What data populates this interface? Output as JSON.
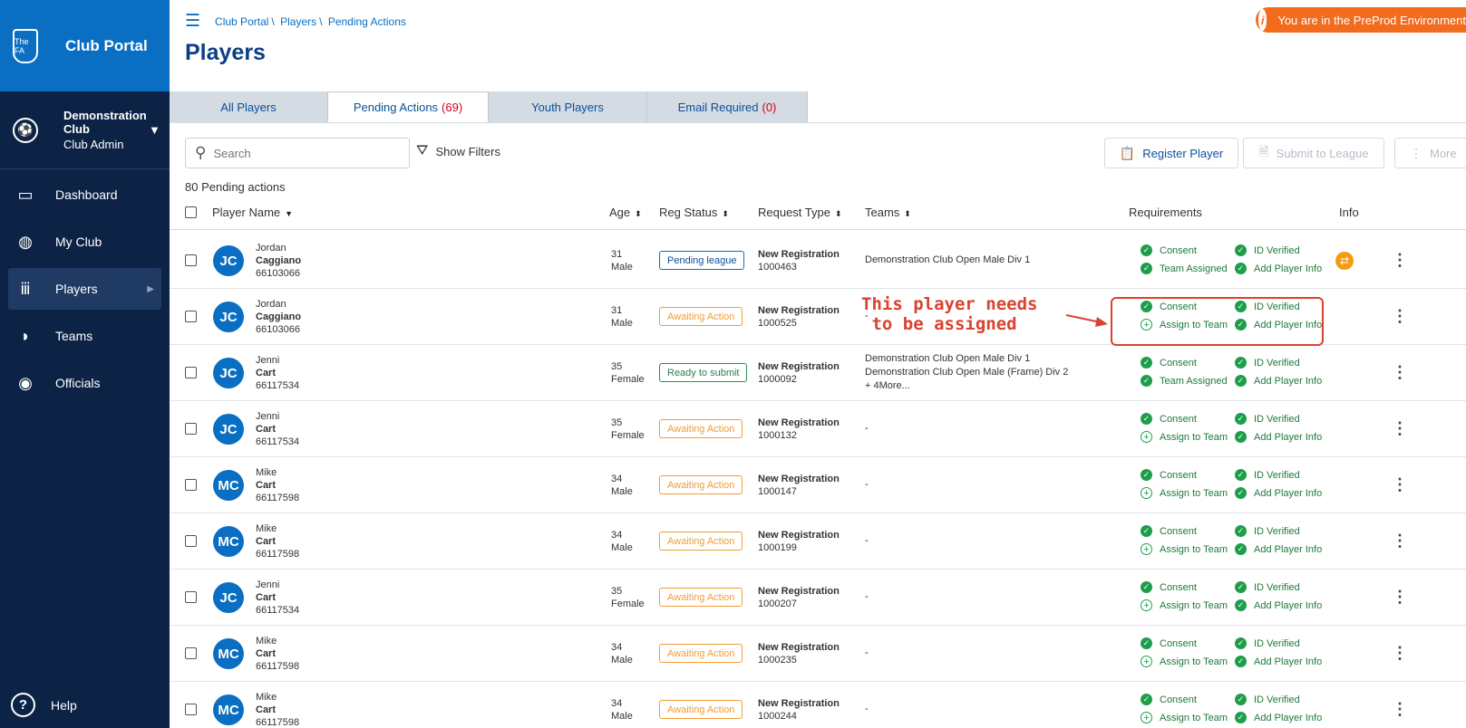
{
  "sidebar": {
    "app_title": "Club Portal",
    "crest_text": "The FA",
    "club_name": "Demonstration Club",
    "club_role": "Club Admin",
    "items": [
      {
        "label": "Dashboard",
        "icon": "dashboard-icon",
        "glyph": "▭"
      },
      {
        "label": "My Club",
        "icon": "shield-icon",
        "glyph": "◍"
      },
      {
        "label": "Players",
        "icon": "players-icon",
        "glyph": "ⅲ"
      },
      {
        "label": "Teams",
        "icon": "teams-icon",
        "glyph": "◗"
      },
      {
        "label": "Officials",
        "icon": "officials-icon",
        "glyph": "◉"
      }
    ],
    "help_label": "Help"
  },
  "breadcrumb": [
    "Club Portal",
    "Players",
    "Pending Actions"
  ],
  "environment_banner": "You are in the PreProd Environment",
  "page_title": "Players",
  "tabs": [
    {
      "label": "All Players",
      "count": ""
    },
    {
      "label": "Pending Actions",
      "count": "(69)"
    },
    {
      "label": "Youth Players",
      "count": ""
    },
    {
      "label": "Email Required",
      "count": "(0)"
    }
  ],
  "search": {
    "placeholder": "Search"
  },
  "show_filters": "Show Filters",
  "actions": {
    "register": "Register Player",
    "submit": "Submit to League",
    "more": "More"
  },
  "pending_count": "80 Pending actions",
  "columns": {
    "player_name": "Player Name",
    "age": "Age",
    "reg_status": "Reg Status",
    "request_type": "Request Type",
    "teams": "Teams",
    "requirements": "Requirements",
    "info": "Info"
  },
  "rows": [
    {
      "initials": "JC",
      "first": "Jordan",
      "last": "Caggiano",
      "id": "66103066",
      "age": "31",
      "gender": "Male",
      "status": "Pending league",
      "status_kind": "pending",
      "req_type": "New Registration",
      "req_no": "1000463",
      "teams": [
        "Demonstration Club Open Male Div 1"
      ],
      "consent": "Consent",
      "team_req": "Team Assigned",
      "team_done": true,
      "id_verified": "ID Verified",
      "player_info": "Add Player Info",
      "has_info": true
    },
    {
      "initials": "JC",
      "first": "Jordan",
      "last": "Caggiano",
      "id": "66103066",
      "age": "31",
      "gender": "Male",
      "status": "Awaiting Action",
      "status_kind": "await",
      "req_type": "New Registration",
      "req_no": "1000525",
      "teams": [
        "-"
      ],
      "consent": "Consent",
      "team_req": "Assign to Team",
      "team_done": false,
      "id_verified": "ID Verified",
      "player_info": "Add Player Info",
      "has_info": false
    },
    {
      "initials": "JC",
      "first": "Jenni",
      "last": "Cart",
      "id": "66117534",
      "age": "35",
      "gender": "Female",
      "status": "Ready to submit",
      "status_kind": "ready",
      "req_type": "New Registration",
      "req_no": "1000092",
      "teams": [
        "Demonstration Club Open Male Div 1",
        "Demonstration Club Open Male (Frame) Div 2",
        "+ 4More..."
      ],
      "consent": "Consent",
      "team_req": "Team Assigned",
      "team_done": true,
      "id_verified": "ID Verified",
      "player_info": "Add Player Info",
      "has_info": false
    },
    {
      "initials": "JC",
      "first": "Jenni",
      "last": "Cart",
      "id": "66117534",
      "age": "35",
      "gender": "Female",
      "status": "Awaiting Action",
      "status_kind": "await",
      "req_type": "New Registration",
      "req_no": "1000132",
      "teams": [
        "-"
      ],
      "consent": "Consent",
      "team_req": "Assign to Team",
      "team_done": false,
      "id_verified": "ID Verified",
      "player_info": "Add Player Info",
      "has_info": false
    },
    {
      "initials": "MC",
      "first": "Mike",
      "last": "Cart",
      "id": "66117598",
      "age": "34",
      "gender": "Male",
      "status": "Awaiting Action",
      "status_kind": "await",
      "req_type": "New Registration",
      "req_no": "1000147",
      "teams": [
        "-"
      ],
      "consent": "Consent",
      "team_req": "Assign to Team",
      "team_done": false,
      "id_verified": "ID Verified",
      "player_info": "Add Player Info",
      "has_info": false
    },
    {
      "initials": "MC",
      "first": "Mike",
      "last": "Cart",
      "id": "66117598",
      "age": "34",
      "gender": "Male",
      "status": "Awaiting Action",
      "status_kind": "await",
      "req_type": "New Registration",
      "req_no": "1000199",
      "teams": [
        "-"
      ],
      "consent": "Consent",
      "team_req": "Assign to Team",
      "team_done": false,
      "id_verified": "ID Verified",
      "player_info": "Add Player Info",
      "has_info": false
    },
    {
      "initials": "JC",
      "first": "Jenni",
      "last": "Cart",
      "id": "66117534",
      "age": "35",
      "gender": "Female",
      "status": "Awaiting Action",
      "status_kind": "await",
      "req_type": "New Registration",
      "req_no": "1000207",
      "teams": [
        "-"
      ],
      "consent": "Consent",
      "team_req": "Assign to Team",
      "team_done": false,
      "id_verified": "ID Verified",
      "player_info": "Add Player Info",
      "has_info": false
    },
    {
      "initials": "MC",
      "first": "Mike",
      "last": "Cart",
      "id": "66117598",
      "age": "34",
      "gender": "Male",
      "status": "Awaiting Action",
      "status_kind": "await",
      "req_type": "New Registration",
      "req_no": "1000235",
      "teams": [
        "-"
      ],
      "consent": "Consent",
      "team_req": "Assign to Team",
      "team_done": false,
      "id_verified": "ID Verified",
      "player_info": "Add Player Info",
      "has_info": false
    },
    {
      "initials": "MC",
      "first": "Mike",
      "last": "Cart",
      "id": "66117598",
      "age": "34",
      "gender": "Male",
      "status": "Awaiting Action",
      "status_kind": "await",
      "req_type": "New Registration",
      "req_no": "1000244",
      "teams": [
        "-"
      ],
      "consent": "Consent",
      "team_req": "Assign to Team",
      "team_done": false,
      "id_verified": "ID Verified",
      "player_info": "Add Player Info",
      "has_info": false
    }
  ],
  "annotation": {
    "text": "This player needs\n to be assigned",
    "color": "#d9432f"
  },
  "colors": {
    "sidebar": "#0c2346",
    "brand_blue": "#0a6fc2",
    "env_orange": "#f36b1c",
    "ok_green": "#1e9e4a"
  }
}
